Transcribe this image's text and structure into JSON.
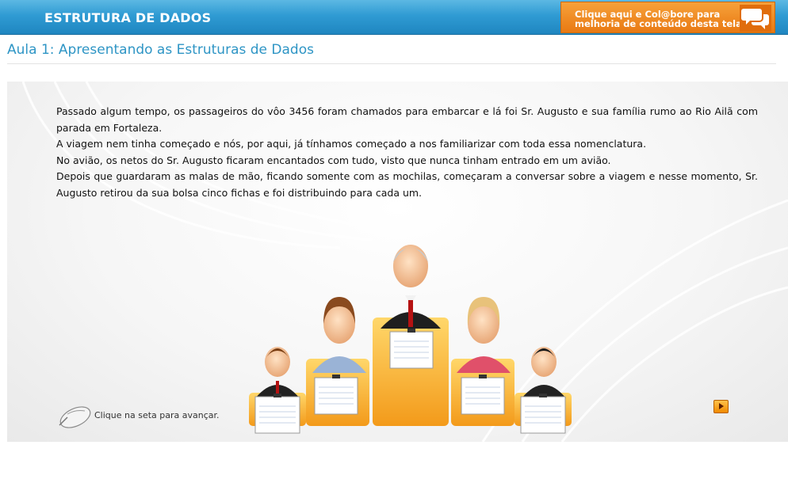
{
  "header": {
    "course_title": "ESTRUTURA DE DADOS",
    "collab_line1": "Clique aqui e Col@bore para",
    "collab_line2": "melhoria de conteúdo desta tela"
  },
  "lesson": {
    "title": "Aula 1: Apresentando as Estruturas de Dados"
  },
  "content": {
    "paragraphs": [
      "Passado algum tempo, os passageiros do vôo 3456 foram chamados para embarcar e lá foi Sr. Augusto e sua família rumo ao Rio Ailã com parada em Fortaleza.",
      "A viagem nem tinha começado e nós, por aqui, já tínhamos começado a nos familiarizar com toda essa nomenclatura.",
      "No avião, os netos do Sr. Augusto ficaram encantados com tudo, visto que nunca tinham entrado em um avião.",
      "Depois que guardaram as malas de mão, ficando somente com as mochilas, começaram a conversar sobre a viagem e nesse momento, Sr. Augusto retirou da sua bolsa cinco fichas e foi distribuindo para cada um."
    ]
  },
  "navigation": {
    "hint": "Clique na seta para avançar."
  },
  "icons": {
    "collab": "speech-bubbles-icon",
    "mouse": "mouse-icon",
    "next": "next-arrow-icon"
  },
  "colors": {
    "header_blue": "#2f9bd3",
    "accent_orange": "#f08a00",
    "title_blue": "#2e95c5"
  }
}
